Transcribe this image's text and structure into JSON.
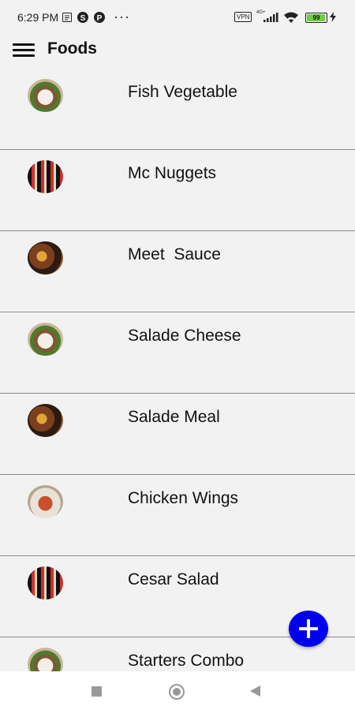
{
  "status_bar": {
    "time": "6:29 PM",
    "dots": "···",
    "vpn": "VPN",
    "network": "4G+",
    "battery": "99"
  },
  "app_bar": {
    "title": "Foods"
  },
  "foods": [
    {
      "name": "Fish Vegetable",
      "image": "plated-dish"
    },
    {
      "name": "Mc Nuggets",
      "image": "packaged-snacks"
    },
    {
      "name": "Meet  Sauce",
      "image": "grilled-meat"
    },
    {
      "name": "Salade Cheese",
      "image": "plated-dish"
    },
    {
      "name": "Salade Meal",
      "image": "grilled-meat"
    },
    {
      "name": "Chicken Wings",
      "image": "chicken-plate"
    },
    {
      "name": "Cesar Salad",
      "image": "packaged-snacks"
    },
    {
      "name": "Starters Combo",
      "image": "plated-dish"
    }
  ],
  "colors": {
    "fab": "#0000ee",
    "background": "#f2f2f2",
    "divider": "#8a8a8a"
  }
}
